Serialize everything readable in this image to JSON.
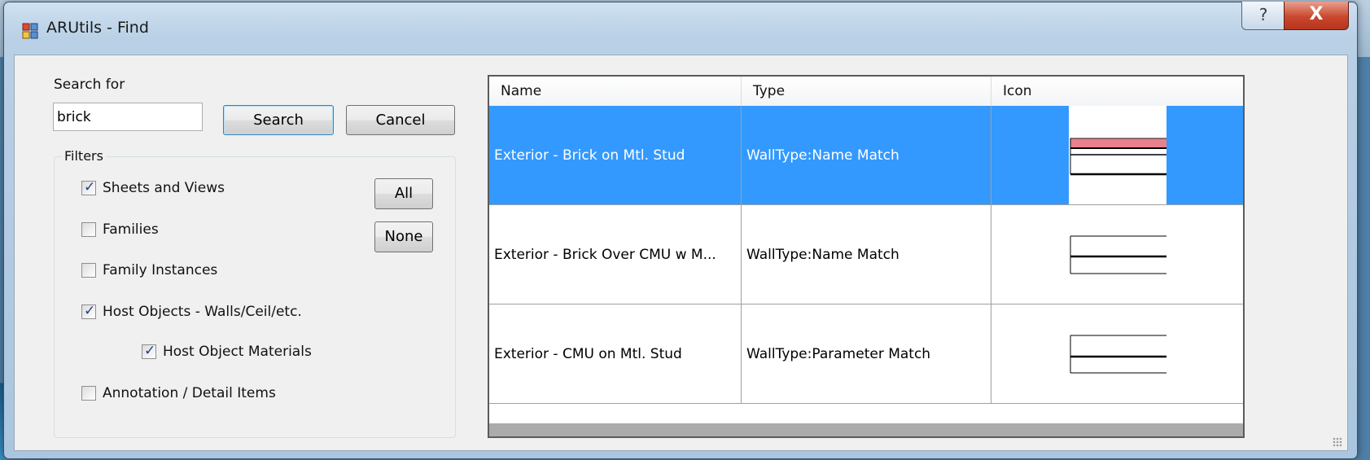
{
  "window": {
    "title": "ARUtils - Find",
    "help_label": "?",
    "close_label": "X"
  },
  "search": {
    "label": "Search for",
    "value": "brick",
    "search_button": "Search",
    "cancel_button": "Cancel"
  },
  "filters": {
    "title": "Filters",
    "all_button": "All",
    "none_button": "None",
    "items": [
      {
        "label": "Sheets and Views",
        "checked": true
      },
      {
        "label": "Families",
        "checked": false
      },
      {
        "label": "Family Instances",
        "checked": false
      },
      {
        "label": "Host Objects - Walls/Ceil/etc.",
        "checked": true
      },
      {
        "label": "Host Object Materials",
        "checked": true
      },
      {
        "label": "Annotation / Detail Items",
        "checked": false
      }
    ]
  },
  "results": {
    "columns": [
      "Name",
      "Type",
      "Icon"
    ],
    "rows": [
      {
        "name": "Exterior - Brick on Mtl. Stud",
        "type": "WallType:Name Match",
        "icon": "wall-brick-stud-icon",
        "selected": true
      },
      {
        "name": "Exterior - Brick Over CMU w M...",
        "type": "WallType:Name Match",
        "icon": "wall-brick-cmu-icon",
        "selected": false
      },
      {
        "name": "Exterior - CMU on Mtl. Stud",
        "type": "WallType:Parameter Match",
        "icon": "wall-cmu-stud-icon",
        "selected": false
      }
    ]
  },
  "colors": {
    "selection": "#3399ff",
    "close_button": "#c9482e",
    "brick_layer": "#e8818c"
  }
}
